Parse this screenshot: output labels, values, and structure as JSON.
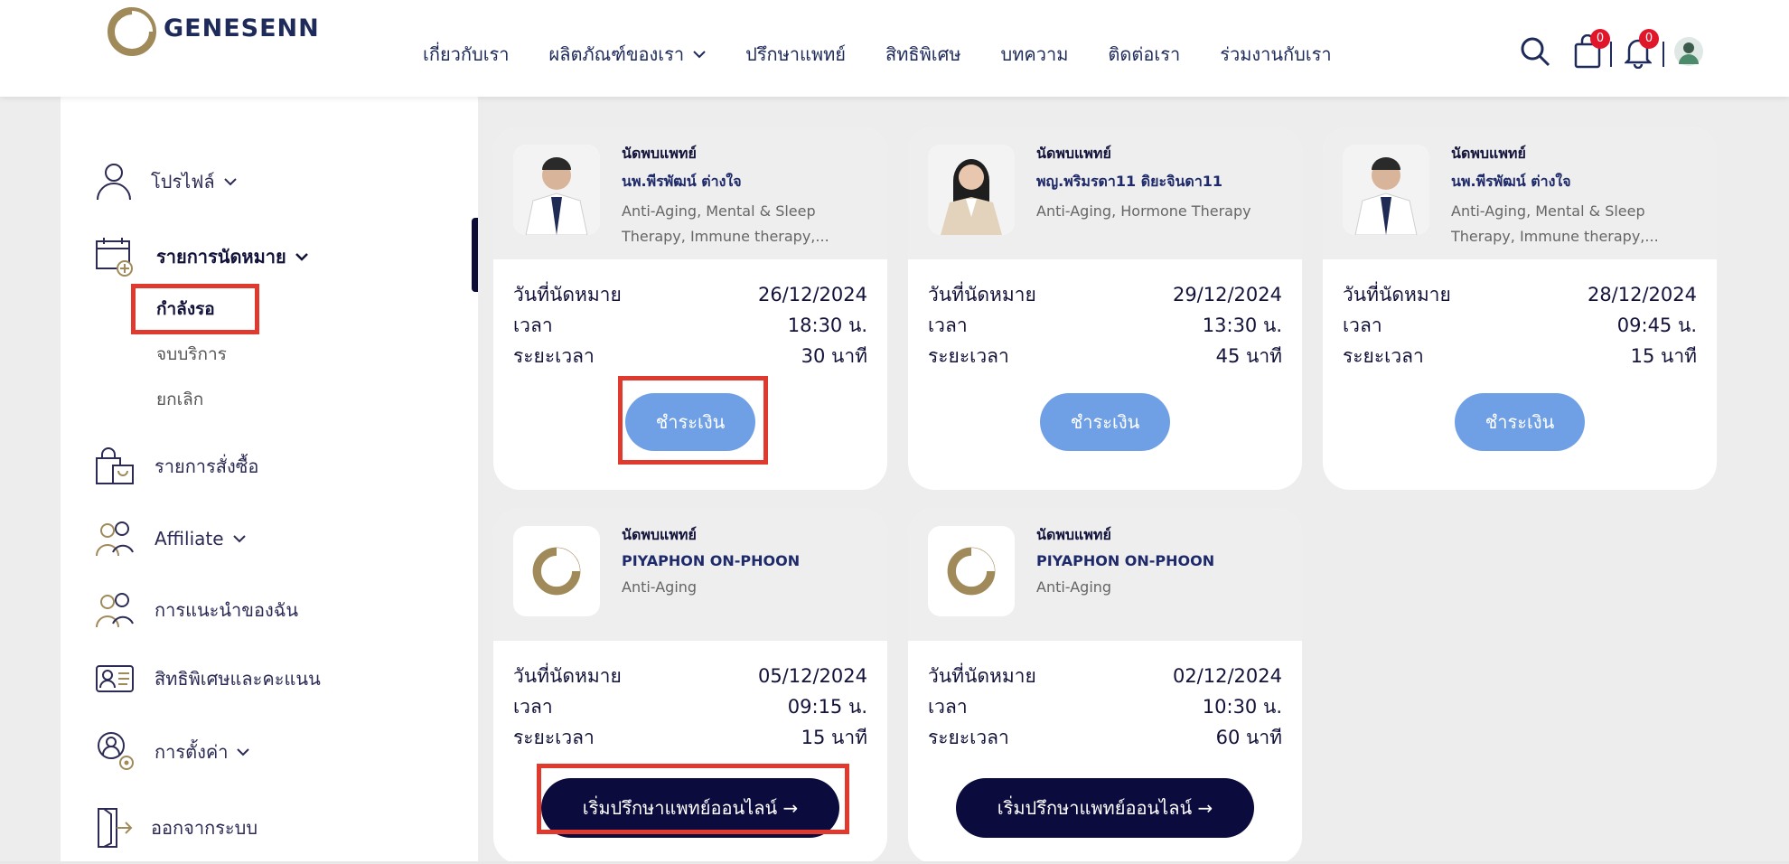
{
  "brand": {
    "name": "GENESENN",
    "color": "#a08a5a"
  },
  "nav": {
    "items": [
      "เกี่ยวกับเรา",
      "ผลิตภัณฑ์ของเรา",
      "ปรึกษาแพทย์",
      "สิทธิพิเศษ",
      "บทความ",
      "ติดต่อเรา",
      "ร่วมงานกับเรา"
    ]
  },
  "header_icons": {
    "cart_count": "0",
    "notification_count": "0"
  },
  "sidebar": {
    "profile": "โปรไฟล์",
    "appointments": "รายการนัดหมาย",
    "sub": [
      "กำลังรอ",
      "จบบริการ",
      "ยกเลิก"
    ],
    "orders": "รายการสั่งซื้อ",
    "affiliate": "Affiliate",
    "referrals": "การแนะนำของฉัน",
    "privileges": "สิทธิพิเศษและคะแนน",
    "settings": "การตั้งค่า",
    "logout": "ออกจากระบบ"
  },
  "labels": {
    "date": "วันที่นัดหมาย",
    "time": "เวลา",
    "duration": "ระยะเวลา"
  },
  "cards": [
    {
      "type": "นัดพบแพทย์",
      "name": "นพ.พีรพัฒน์ ต่างใจ",
      "spec": "Anti-Aging, Mental & Sleep Therapy, Immune therapy,...",
      "date": "26/12/2024",
      "time": "18:30 น.",
      "duration": "30 นาที",
      "button": "ชำระเงิน"
    },
    {
      "type": "นัดพบแพทย์",
      "name": "พญ.พริมรดา11 ดิยะจินดา11",
      "spec": "Anti-Aging, Hormone Therapy",
      "date": "29/12/2024",
      "time": "13:30 น.",
      "duration": "45 นาที",
      "button": "ชำระเงิน"
    },
    {
      "type": "นัดพบแพทย์",
      "name": "นพ.พีรพัฒน์ ต่างใจ",
      "spec": "Anti-Aging, Mental & Sleep Therapy, Immune therapy,...",
      "date": "28/12/2024",
      "time": "09:45 น.",
      "duration": "15 นาที",
      "button": "ชำระเงิน"
    },
    {
      "type": "นัดพบแพทย์",
      "name": "PIYAPHON ON-PHOON",
      "spec": "Anti-Aging",
      "date": "05/12/2024",
      "time": "09:15 น.",
      "duration": "15 นาที",
      "button": "เริ่มปรึกษาแพทย์ออนไลน์ →"
    },
    {
      "type": "นัดพบแพทย์",
      "name": "PIYAPHON ON-PHOON",
      "spec": "Anti-Aging",
      "date": "02/12/2024",
      "time": "10:30 น.",
      "duration": "60 นาที",
      "button": "เริ่มปรึกษาแพทย์ออนไลน์ →"
    }
  ]
}
